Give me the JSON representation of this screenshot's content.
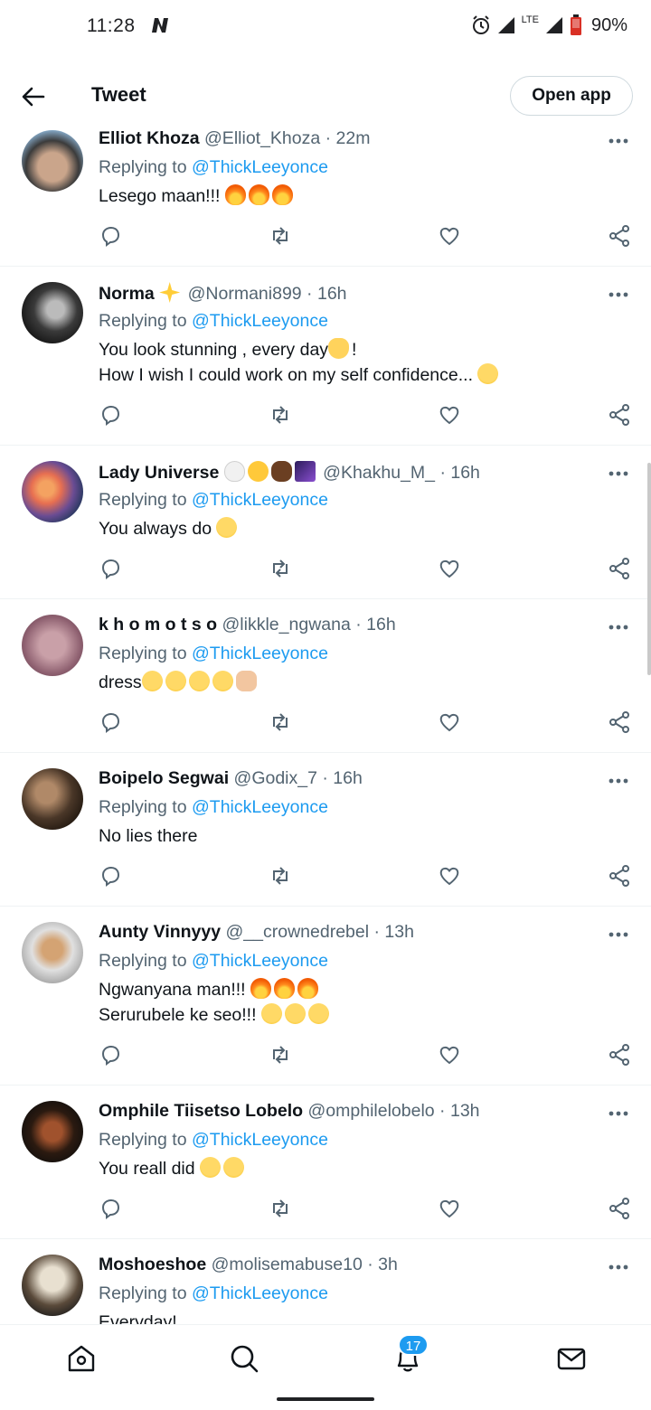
{
  "status_bar": {
    "time": "11:28",
    "network": "LTE",
    "battery": "90%"
  },
  "header": {
    "title": "Tweet",
    "open_app": "Open app"
  },
  "replying_prefix": "Replying to ",
  "reply_target": "@ThickLeeyonce",
  "tweets": [
    {
      "name": "Elliot Khoza",
      "handle_time": "@Elliot_Khoza · 22m",
      "lines": [
        "Lesego maan!!!"
      ]
    },
    {
      "name": "Norma",
      "handle_time": "@Normani899 · 16h",
      "lines": [
        "You look stunning , every day",
        "How I wish I could work on my self confidence..."
      ]
    },
    {
      "name": "Lady Universe",
      "handle_time": "@Khakhu_M_ · 16h",
      "lines": [
        "You always do"
      ]
    },
    {
      "name": "k h o m o t s o",
      "handle_time": "@likkle_ngwana · 16h",
      "lines": [
        "dress"
      ]
    },
    {
      "name": "Boipelo Segwai",
      "handle_time": "@Godix_7 · 16h",
      "lines": [
        "No lies there"
      ]
    },
    {
      "name": "Aunty Vinnyyy",
      "handle_time": "@__crownedrebel · 13h",
      "lines": [
        "Ngwanyana man!!!",
        "Serurubele ke seo!!!"
      ]
    },
    {
      "name": "Omphile Tiisetso Lobelo",
      "handle_time": "@omphilelobelo · 13h",
      "lines": [
        "You reall did"
      ]
    },
    {
      "name": "Moshoeshoe",
      "handle_time": "@molisemabuse10 · 3h",
      "lines": [
        "Everyday!"
      ]
    }
  ],
  "line_extras": {
    "exclaim": "!"
  },
  "bottom_nav": {
    "notifications_badge": "17"
  },
  "colors": {
    "link": "#1d9bf0",
    "secondary_text": "#536471",
    "primary_text": "#0f1419",
    "divider": "#eff3f4"
  },
  "icons": [
    "back-arrow-icon",
    "more-icon",
    "reply-icon",
    "retweet-icon",
    "like-icon",
    "share-icon",
    "home-icon",
    "search-icon",
    "notifications-icon",
    "messages-icon"
  ]
}
